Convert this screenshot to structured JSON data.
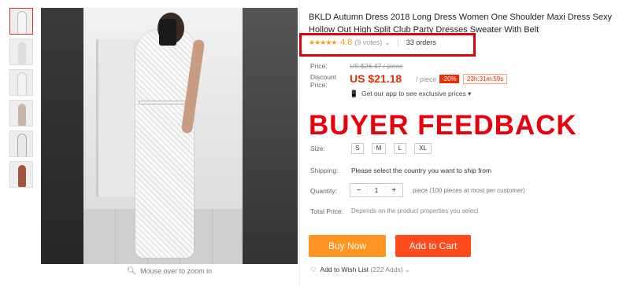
{
  "product": {
    "title": "BKLD Autumn Dress 2018 Long Dress Women One Shoulder Maxi Dress Sexy Hollow Out High Split Club Party Dresses Sweater With Belt",
    "stars": "★★★★★",
    "rating": "4.8",
    "votes": "(9 votes)",
    "votes_chevron": "⌄",
    "orders": "33 orders",
    "rating_sep": "|"
  },
  "price": {
    "label": "Price:",
    "old": "US $26.47 / piece",
    "discount_label": "Discount Price:",
    "new": "US $21.18",
    "per": "/ piece",
    "discount_badge": "-20%",
    "timer": "23h:31m:59s",
    "app_text": "Get our app to see exclusive prices",
    "app_chevron": "▾",
    "app_icon": "📱"
  },
  "overlay_text": "BUYER FEEDBACK",
  "size": {
    "label": "Size:",
    "options": [
      "S",
      "M",
      "L",
      "XL"
    ]
  },
  "shipping": {
    "label": "Shipping:",
    "text": "Please select the country you want to ship from"
  },
  "quantity": {
    "label": "Quantity:",
    "minus": "−",
    "value": "1",
    "plus": "+",
    "note": "piece (100 pieces at most per customer)"
  },
  "total": {
    "label": "Total Price:",
    "text": "Depends on the product properties you select"
  },
  "buttons": {
    "buy_now": "Buy Now",
    "add_to_cart": "Add to Cart"
  },
  "wishlist": {
    "icon": "♡",
    "label": "Add to Wish List",
    "count": "(222 Adds)",
    "chevron": "⌄"
  },
  "zoom": {
    "icon": "🔍︎",
    "text": "Mouse over to zoom in"
  },
  "colors": {
    "accent_red": "#e62e04",
    "buy_now": "#ff9623",
    "add_to_cart": "#ff4a1c",
    "annotation_red": "#e8000a",
    "star": "#f39c12"
  },
  "icons": [
    "search-icon",
    "phone-icon",
    "heart-icon",
    "chevron-down-icon"
  ]
}
